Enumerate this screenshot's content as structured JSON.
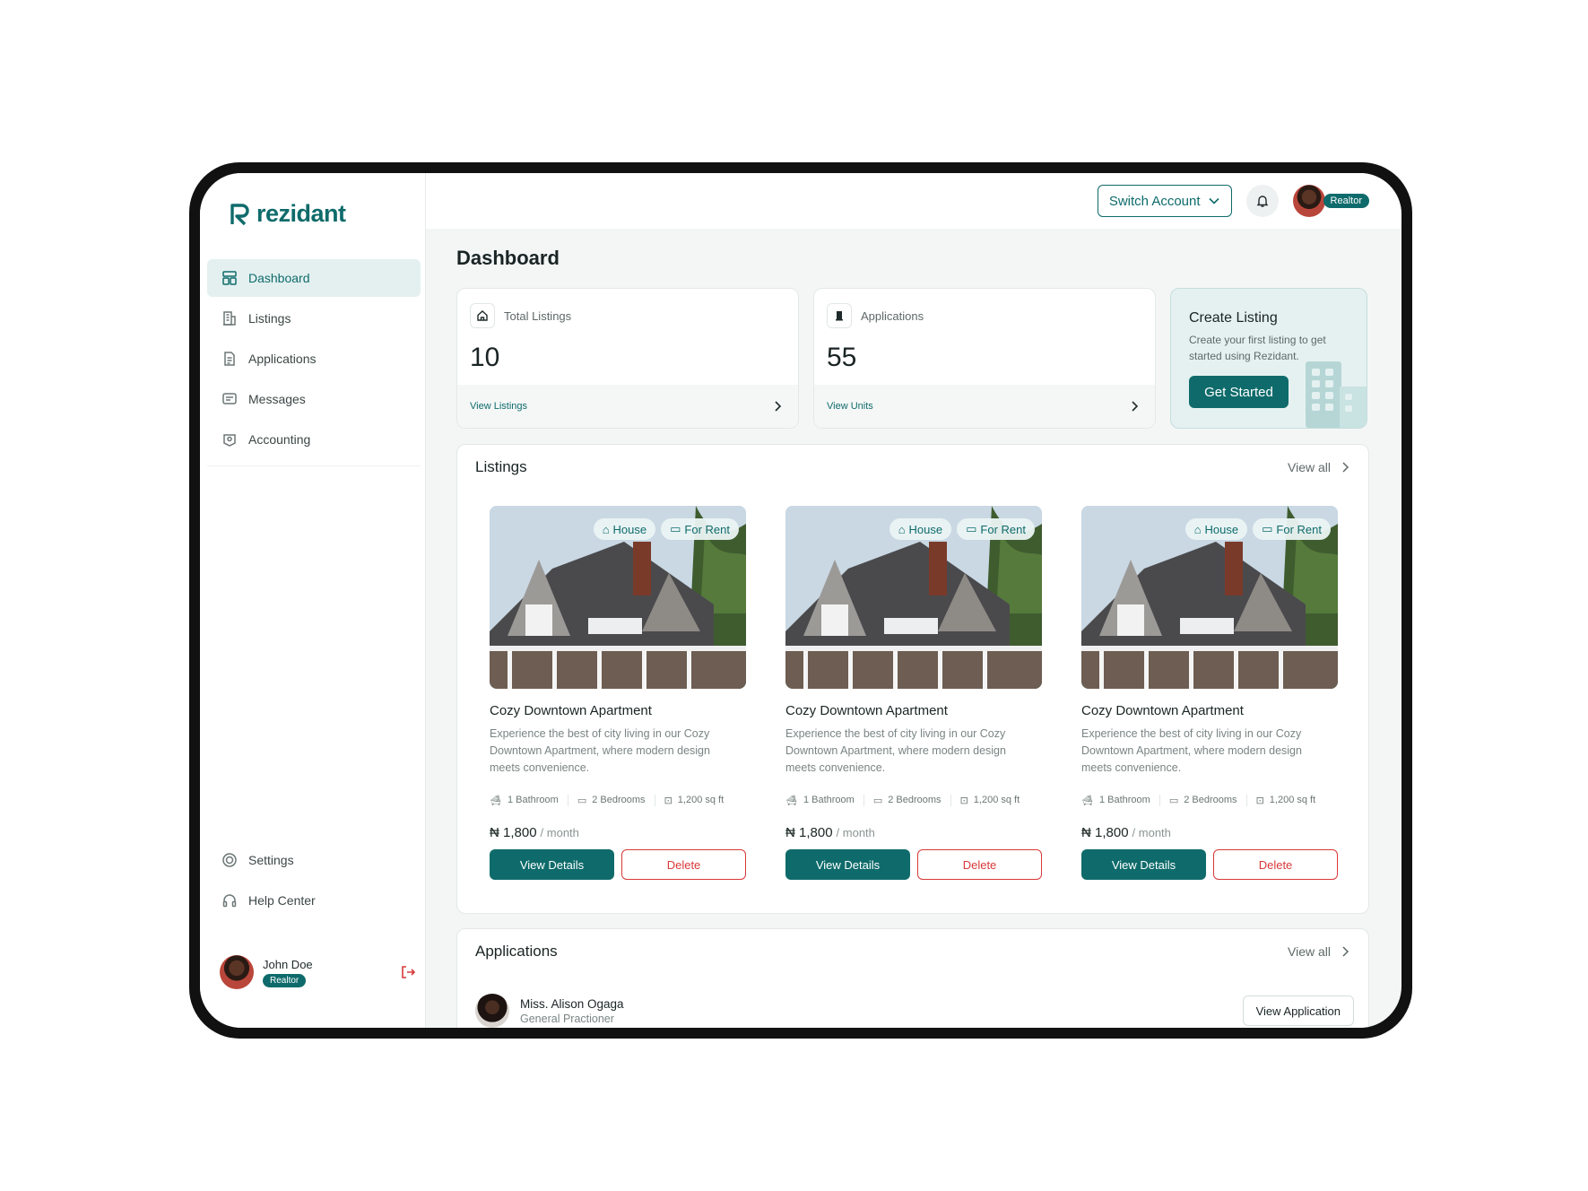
{
  "brand": {
    "name": "rezidant",
    "color": "#0f6b6b"
  },
  "sidebar": {
    "items": [
      {
        "label": "Dashboard",
        "icon": "dashboard-icon",
        "active": true
      },
      {
        "label": "Listings",
        "icon": "building-icon"
      },
      {
        "label": "Applications",
        "icon": "document-icon"
      },
      {
        "label": "Messages",
        "icon": "message-icon"
      },
      {
        "label": "Accounting",
        "icon": "wallet-icon"
      }
    ],
    "bottom_items": [
      {
        "label": "Settings",
        "icon": "gear-icon"
      },
      {
        "label": "Help Center",
        "icon": "headset-icon"
      }
    ],
    "user": {
      "name": "John Doe",
      "role": "Realtor"
    }
  },
  "topbar": {
    "switch_account": "Switch Account",
    "role_badge": "Realtor"
  },
  "page": {
    "title": "Dashboard"
  },
  "stats": [
    {
      "label": "Total Listings",
      "value": "10",
      "link": "View Listings",
      "icon": "home-icon"
    },
    {
      "label": "Applications",
      "value": "55",
      "link": "View Units",
      "icon": "door-icon"
    }
  ],
  "create_listing": {
    "title": "Create Listing",
    "description": "Create your first listing to get started using Rezidant.",
    "button": "Get Started"
  },
  "listings": {
    "title": "Listings",
    "view_all": "View all",
    "items": [
      {
        "tag_type": "House",
        "tag_status": "For Rent",
        "name": "Cozy Downtown Apartment",
        "description": "Experience the best of city living in our Cozy Downtown Apartment, where modern design meets convenience.",
        "bath": "1 Bathroom",
        "beds": "2 Bedrooms",
        "area": "1,200 sq ft",
        "price": "₦ 1,800",
        "unit": "/ month",
        "view": "View Details",
        "delete": "Delete"
      },
      {
        "tag_type": "House",
        "tag_status": "For Rent",
        "name": "Cozy Downtown Apartment",
        "description": "Experience the best of city living in our Cozy Downtown Apartment, where modern design meets convenience.",
        "bath": "1 Bathroom",
        "beds": "2 Bedrooms",
        "area": "1,200 sq ft",
        "price": "₦ 1,800",
        "unit": "/ month",
        "view": "View Details",
        "delete": "Delete"
      },
      {
        "tag_type": "House",
        "tag_status": "For Rent",
        "name": "Cozy Downtown Apartment",
        "description": "Experience the best of city living in our Cozy Downtown Apartment, where modern design meets convenience.",
        "bath": "1 Bathroom",
        "beds": "2 Bedrooms",
        "area": "1,200 sq ft",
        "price": "₦ 1,800",
        "unit": "/ month",
        "view": "View Details",
        "delete": "Delete"
      }
    ]
  },
  "applications": {
    "title": "Applications",
    "view_all": "View all",
    "items": [
      {
        "name": "Miss. Alison Ogaga",
        "role": "General Practioner",
        "button": "View Application"
      }
    ]
  }
}
